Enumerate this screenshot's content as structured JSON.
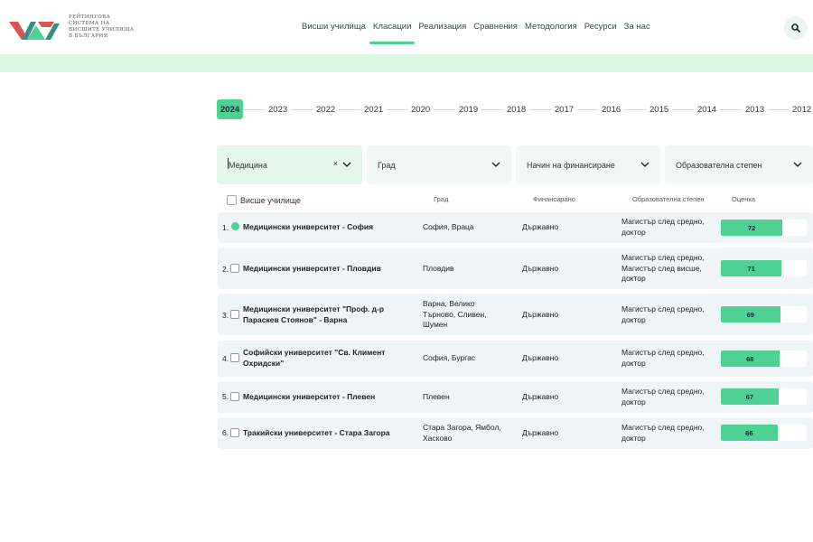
{
  "header": {
    "logo_lines": [
      "Рейтингова",
      "система на",
      "висшите училища",
      "в България"
    ],
    "nav": [
      {
        "label": "Висши училища",
        "active": false
      },
      {
        "label": "Класации",
        "active": true
      },
      {
        "label": "Реализация",
        "active": false
      },
      {
        "label": "Сравнения",
        "active": false
      },
      {
        "label": "Методология",
        "active": false
      },
      {
        "label": "Ресурси",
        "active": false
      },
      {
        "label": "За нас",
        "active": false
      }
    ],
    "search_icon": "search-icon"
  },
  "years": {
    "active": "2024",
    "items": [
      "2024",
      "2023",
      "2022",
      "2021",
      "2020",
      "2019",
      "2018",
      "2017",
      "2016",
      "2015",
      "2014",
      "2013",
      "2012"
    ]
  },
  "filters": {
    "field": {
      "value": "Медицина",
      "clear": "×"
    },
    "city": {
      "placeholder": "Град"
    },
    "financing": {
      "placeholder": "Начин на финансиране"
    },
    "degree": {
      "placeholder": "Образователна степен"
    }
  },
  "table": {
    "headers": {
      "university": "Висше училище",
      "city": "Град",
      "financing": "Финансирано",
      "degree": "Образователна степен",
      "score": "Оценка"
    },
    "rows": [
      {
        "rank": "1.",
        "name": "Медицински университет - София",
        "city": "София, Враца",
        "financing": "Държавно",
        "degree": "Магистър след средно, доктор",
        "score": 72,
        "marker": "dot"
      },
      {
        "rank": "2.",
        "name": "Медицински университет - Пловдив",
        "city": "Пловдив",
        "financing": "Държавно",
        "degree": "Магистър след средно, Магистър след висше, доктор",
        "score": 71,
        "marker": "checkbox"
      },
      {
        "rank": "3.",
        "name": "Медицински университет \"Проф. д-р Параскев Стоянов\" - Варна",
        "city": "Варна, Велико Търново, Сливен, Шумен",
        "financing": "Държавно",
        "degree": "Магистър след средно, доктор",
        "score": 69,
        "marker": "checkbox"
      },
      {
        "rank": "4.",
        "name": "Софийски университет \"Св. Климент Охридски\"",
        "city": "София, Бургас",
        "financing": "Държавно",
        "degree": "Магистър след средно, доктор",
        "score": 68,
        "marker": "checkbox"
      },
      {
        "rank": "5.",
        "name": "Медицински университет - Плевен",
        "city": "Плевен",
        "financing": "Държавно",
        "degree": "Магистър след средно, доктор",
        "score": 67,
        "marker": "checkbox"
      },
      {
        "rank": "6.",
        "name": "Тракийски университет - Стара Загора",
        "city": "Стара Загора, Ямбол, Хасково",
        "financing": "Държавно",
        "degree": "Магистър след средно, доктор",
        "score": 66,
        "marker": "checkbox"
      }
    ]
  },
  "colors": {
    "accent": "#4fd194",
    "band": "#dbf6e3",
    "row_bg": "#eff4f7"
  }
}
